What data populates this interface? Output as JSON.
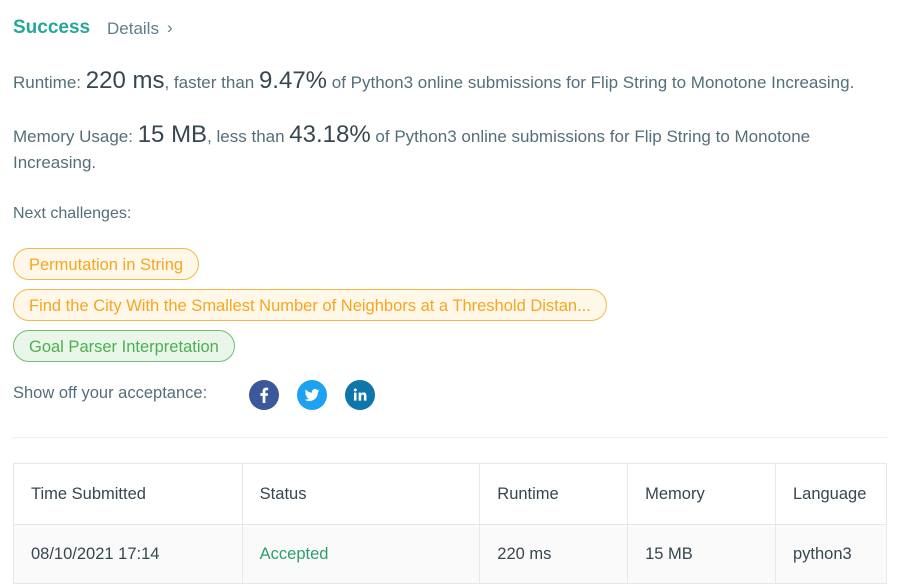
{
  "header": {
    "status": "Success",
    "details_label": "Details",
    "chevron_glyph": "›"
  },
  "runtime": {
    "label": "Runtime: ",
    "value": "220 ms",
    "mid": ", faster than ",
    "percent": "9.47%",
    "suffix": " of Python3 online submissions for Flip String to Monotone Increasing."
  },
  "memory": {
    "label": "Memory Usage: ",
    "value": "15 MB",
    "mid": ", less than ",
    "percent": "43.18%",
    "suffix": " of Python3 online submissions for Flip String to Monotone Increasing."
  },
  "next_challenges": {
    "label": "Next challenges:",
    "items": [
      {
        "label": "Permutation in String",
        "difficulty": "medium"
      },
      {
        "label": "Find the City With the Smallest Number of Neighbors at a Threshold Distan...",
        "difficulty": "medium"
      },
      {
        "label": "Goal Parser Interpretation",
        "difficulty": "easy"
      }
    ]
  },
  "share": {
    "label": "Show off your acceptance:",
    "icons": [
      {
        "name": "facebook-icon",
        "color": "#3b5998"
      },
      {
        "name": "twitter-icon",
        "color": "#1da1f2"
      },
      {
        "name": "linkedin-icon",
        "color": "#0e76a8"
      }
    ]
  },
  "submissions": {
    "headers": [
      "Time Submitted",
      "Status",
      "Runtime",
      "Memory",
      "Language"
    ],
    "rows": [
      [
        "08/10/2021 17:14",
        "Accepted",
        "220 ms",
        "15 MB",
        "python3"
      ]
    ]
  },
  "colors": {
    "success": "#26a69a",
    "medium_difficulty": "#f5a623",
    "easy_difficulty": "#4caf50",
    "accepted": "#2e9e6e"
  }
}
